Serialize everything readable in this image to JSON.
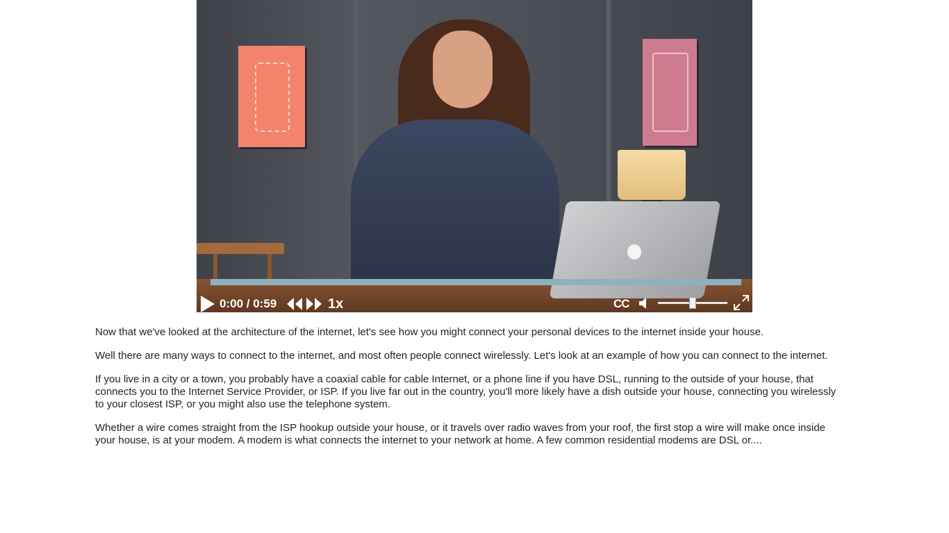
{
  "player": {
    "current_time": "0:00",
    "duration": "0:59",
    "time_separator": " / ",
    "speed_label": "1x",
    "captions_label": "CC",
    "progress_played": 0,
    "volume_level": 0.5,
    "icons": {
      "play": "play-icon",
      "rewind": "rewind-icon",
      "forward": "fast-forward-icon",
      "volume": "volume-icon",
      "fullscreen": "fullscreen-icon"
    },
    "colors": {
      "progress_track": "#8fb1bd",
      "controls_text": "#ffffff"
    }
  },
  "transcript": {
    "paragraphs": [
      "Now that we've looked at the architecture of the internet, let's see how you might connect your personal devices to the internet inside your house.",
      "Well there are many ways to connect to the internet, and most often people connect wirelessly. Let's look at an example of how you can connect to the internet.",
      "If you live in a city or a town, you probably have a coaxial cable for cable Internet, or a phone line if you have DSL, running to the outside of your house, that connects you to the Internet Service Provider, or ISP. If you live far out in the country, you'll more likely have a dish outside your house, connecting you wirelessly to your closest ISP, or you might also use the telephone system.",
      "Whether a wire comes straight from the ISP hookup outside your house, or it travels over radio waves from your roof, the first stop a wire will make once inside your house, is at your modem. A modem is what connects the internet to your network at home. A few common residential modems are DSL or...."
    ]
  }
}
